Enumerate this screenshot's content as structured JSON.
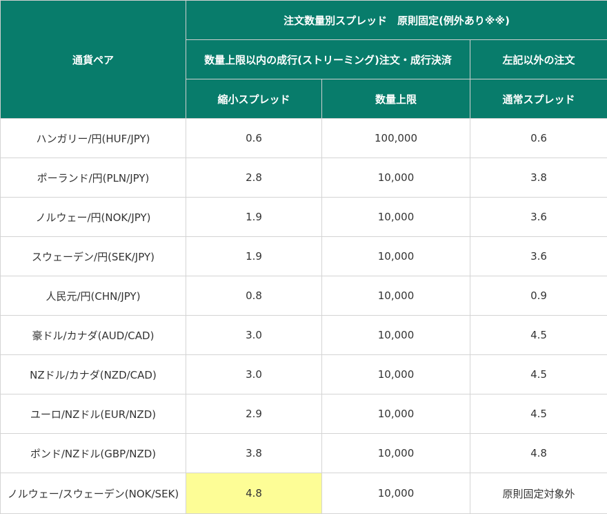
{
  "header": {
    "pair": "通貨ペア",
    "group_fixed": "注文数量別スプレッド　原則固定(例外あり※※)",
    "group_streaming": "数量上限以内の成行(ストリーミング)注文・成行決済",
    "group_other": "左記以外の注文",
    "reduced_spread": "縮小スプレッド",
    "qty_limit": "数量上限",
    "normal_spread": "通常スプレッド"
  },
  "rows": [
    {
      "pair": "ハンガリー/円(HUF/JPY)",
      "reduced": "0.6",
      "limit": "100,000",
      "normal": "0.6"
    },
    {
      "pair": "ポーランド/円(PLN/JPY)",
      "reduced": "2.8",
      "limit": "10,000",
      "normal": "3.8"
    },
    {
      "pair": "ノルウェー/円(NOK/JPY)",
      "reduced": "1.9",
      "limit": "10,000",
      "normal": "3.6"
    },
    {
      "pair": "スウェーデン/円(SEK/JPY)",
      "reduced": "1.9",
      "limit": "10,000",
      "normal": "3.6"
    },
    {
      "pair": "人民元/円(CHN/JPY)",
      "reduced": "0.8",
      "limit": "10,000",
      "normal": "0.9"
    },
    {
      "pair": "豪ドル/カナダ(AUD/CAD)",
      "reduced": "3.0",
      "limit": "10,000",
      "normal": "4.5"
    },
    {
      "pair": "NZドル/カナダ(NZD/CAD)",
      "reduced": "3.0",
      "limit": "10,000",
      "normal": "4.5"
    },
    {
      "pair": "ユーロ/NZドル(EUR/NZD)",
      "reduced": "2.9",
      "limit": "10,000",
      "normal": "4.5"
    },
    {
      "pair": "ポンド/NZドル(GBP/NZD)",
      "reduced": "3.8",
      "limit": "10,000",
      "normal": "4.8"
    },
    {
      "pair": "ノルウェー/スウェーデン(NOK/SEK)",
      "reduced": "4.8",
      "limit": "10,000",
      "normal": "原則固定対象外"
    }
  ],
  "colors": {
    "header_bg": "#087c6b",
    "highlight": "#fdfd96"
  }
}
